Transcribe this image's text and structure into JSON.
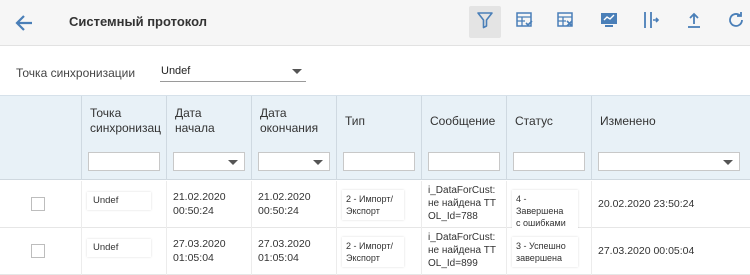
{
  "header": {
    "title": "Системный протокол"
  },
  "sync": {
    "label": "Точка синхронизации",
    "value": "Undef"
  },
  "table": {
    "columns": [
      {
        "line1": "Точка",
        "line2": "синхронизац"
      },
      {
        "line1": "Дата",
        "line2": "начала"
      },
      {
        "line1": "Дата",
        "line2": "окончания"
      },
      {
        "line1": "Тип",
        "line2": ""
      },
      {
        "line1": "Сообщение",
        "line2": ""
      },
      {
        "line1": "Статус",
        "line2": ""
      },
      {
        "line1": "Изменено",
        "line2": ""
      }
    ],
    "rows": [
      {
        "sync_point": "Undef",
        "start_l1": "21.02.2020",
        "start_l2": "00:50:24",
        "end_l1": "21.02.2020",
        "end_l2": "00:50:24",
        "type_l1": "2 - Импорт/",
        "type_l2": "Экспорт",
        "msg_l1": "i_DataForCust:",
        "msg_l2": "не найдена ТТ",
        "msg_l3": "OL_Id=788",
        "status_l1": "4 - Завершена",
        "status_l2": "с ошибками",
        "changed": "20.02.2020 23:50:24"
      },
      {
        "sync_point": "Undef",
        "start_l1": "27.03.2020",
        "start_l2": "01:05:04",
        "end_l1": "27.03.2020",
        "end_l2": "01:05:04",
        "type_l1": "2 - Импорт/",
        "type_l2": "Экспорт",
        "msg_l1": "i_DataForCust:",
        "msg_l2": "не найдена ТТ",
        "msg_l3": "OL_Id=899",
        "status_l1": "3 - Успешно",
        "status_l2": "завершена",
        "changed": "27.03.2020 00:05:04"
      }
    ]
  },
  "icons": {
    "accent": "#4a7fb8",
    "toolbar": [
      "filter-icon",
      "grid-check-icon",
      "grid-remove-icon",
      "export-screen-icon",
      "split-columns-icon",
      "upload-icon",
      "refresh-icon"
    ]
  }
}
